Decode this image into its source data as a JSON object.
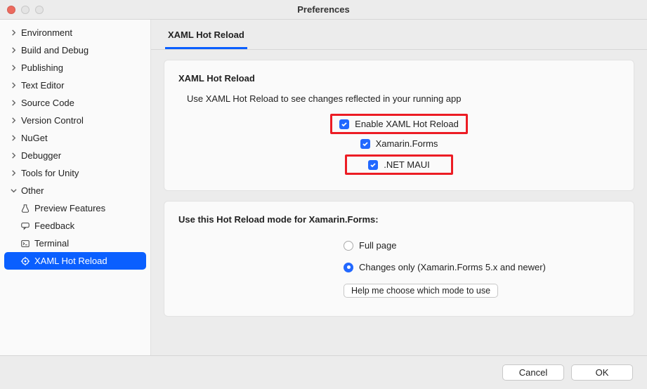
{
  "window": {
    "title": "Preferences"
  },
  "sidebar": {
    "items": [
      {
        "label": "Environment",
        "expanded": false
      },
      {
        "label": "Build and Debug",
        "expanded": false
      },
      {
        "label": "Publishing",
        "expanded": false
      },
      {
        "label": "Text Editor",
        "expanded": false
      },
      {
        "label": "Source Code",
        "expanded": false
      },
      {
        "label": "Version Control",
        "expanded": false
      },
      {
        "label": "NuGet",
        "expanded": false
      },
      {
        "label": "Debugger",
        "expanded": false
      },
      {
        "label": "Tools for Unity",
        "expanded": false
      },
      {
        "label": "Other",
        "expanded": true
      }
    ],
    "other_children": [
      {
        "label": "Preview Features",
        "icon": "flask"
      },
      {
        "label": "Feedback",
        "icon": "speech"
      },
      {
        "label": "Terminal",
        "icon": "terminal"
      },
      {
        "label": "XAML Hot Reload",
        "icon": "target",
        "selected": true
      }
    ]
  },
  "tab": {
    "label": "XAML Hot Reload"
  },
  "section1": {
    "title": "XAML Hot Reload",
    "description": "Use XAML Hot Reload to see changes reflected in your running app",
    "enable_label": "Enable XAML Hot Reload",
    "enable_checked": true,
    "opt_xamarin_label": "Xamarin.Forms",
    "opt_xamarin_checked": true,
    "opt_maui_label": ".NET MAUI",
    "opt_maui_checked": true
  },
  "section2": {
    "title": "Use this Hot Reload mode for Xamarin.Forms:",
    "radio_full_label": "Full page",
    "radio_full_checked": false,
    "radio_changes_label": "Changes only (Xamarin.Forms 5.x and newer)",
    "radio_changes_checked": true,
    "help_button": "Help me choose which mode to use"
  },
  "footer": {
    "cancel": "Cancel",
    "ok": "OK"
  }
}
